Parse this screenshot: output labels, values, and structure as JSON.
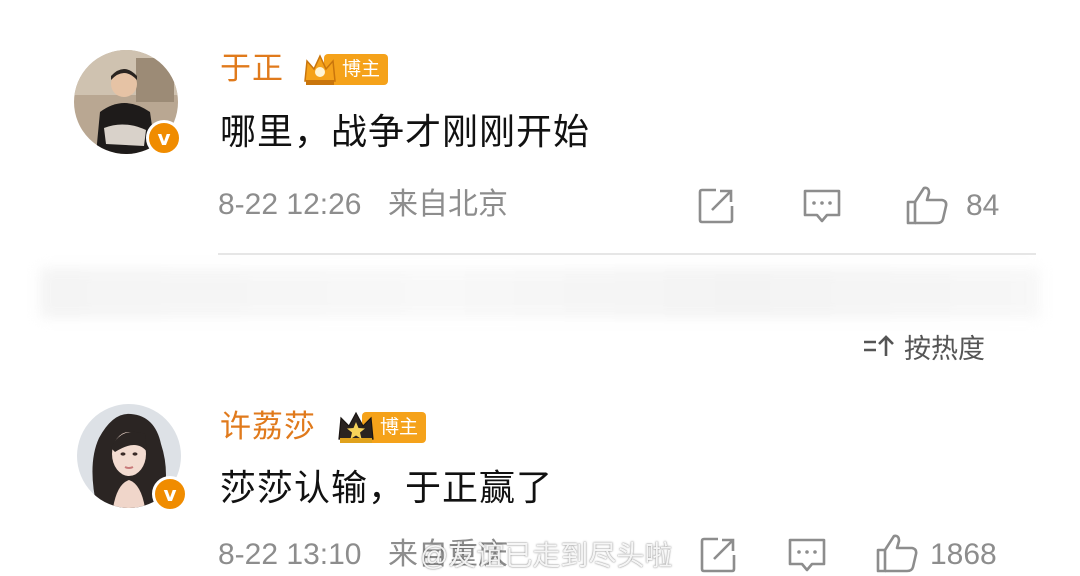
{
  "comments": [
    {
      "author": "于正",
      "badge": "博主",
      "text": "哪里，战争才刚刚开始",
      "date": "8-22 12:26",
      "location": "来自北京",
      "likes": "84",
      "avatar_icon": "person-photo-avatar",
      "verified_badge": "v"
    },
    {
      "author": "许荔莎",
      "badge": "博主",
      "text": "莎莎认输，于正赢了",
      "date": "8-22 13:10",
      "location": "来自重庆",
      "likes": "1868",
      "avatar_icon": "person-photo-avatar",
      "verified_badge": "v"
    }
  ],
  "sort": {
    "label": "按热度",
    "icon": "sort-icon"
  },
  "watermark": "@友谊已走到尽头啦",
  "colors": {
    "name": "#e07a1c",
    "badge": "#f5a21a",
    "meta": "#8d8d8d",
    "verified": "#f08c00"
  }
}
